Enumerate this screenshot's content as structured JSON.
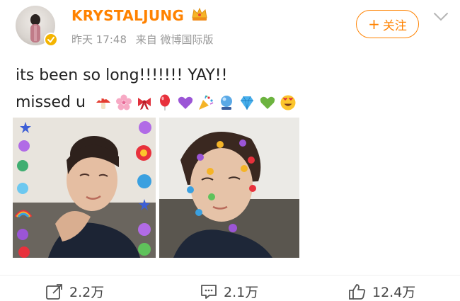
{
  "post": {
    "author": {
      "name": "KRYSTALJUNG",
      "avatar_icon": "avatar-photo",
      "verified_icon": "verified-badge-icon",
      "badge_icon": "crown-icon"
    },
    "meta": {
      "time": "昨天 17:48",
      "source": "来自 微博国际版"
    },
    "follow_label": "关注",
    "menu_icon": "chevron-down-icon",
    "text": {
      "line1": "its been so long!!!!!!! YAY!!",
      "line2": "missed u",
      "emojis": [
        "mushroom",
        "cherry-blossom",
        "ribbon",
        "balloon",
        "purple-heart",
        "party-popper",
        "crystal-ball",
        "gem",
        "green-heart",
        "heart-eyes"
      ]
    },
    "images": [
      {
        "name": "post-photo-1",
        "description_icon": "photo-icon"
      },
      {
        "name": "post-photo-2",
        "description_icon": "photo-icon"
      }
    ]
  },
  "actions": {
    "repost": {
      "icon": "repost-icon",
      "count": "2.2万"
    },
    "comment": {
      "icon": "comment-icon",
      "count": "2.1万"
    },
    "like": {
      "icon": "like-icon",
      "count": "12.4万"
    }
  },
  "colors": {
    "brand_orange": "#ff8200",
    "meta_gray": "#999999",
    "text": "#222222"
  }
}
